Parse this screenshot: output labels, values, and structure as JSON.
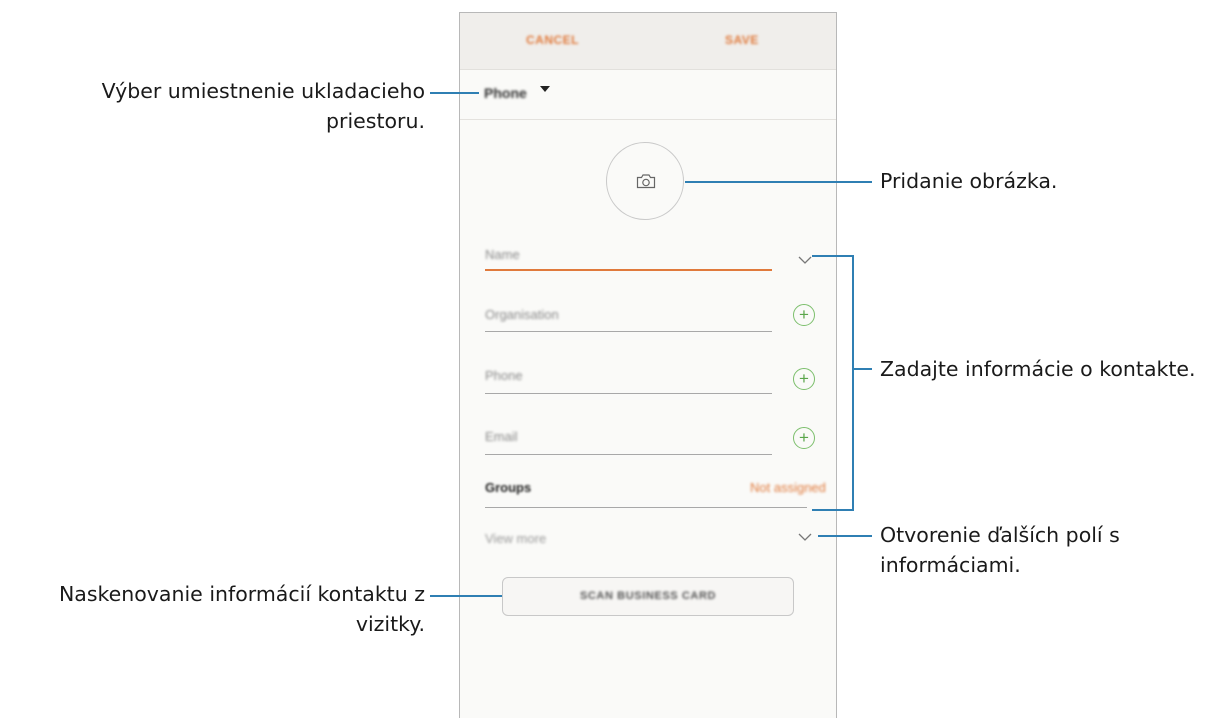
{
  "topbar": {
    "cancel_label": "CANCEL",
    "save_label": "SAVE"
  },
  "storage": {
    "label": "Phone"
  },
  "fields": {
    "name_placeholder": "Name",
    "organisation_placeholder": "Organisation",
    "phone_placeholder": "Phone",
    "email_placeholder": "Email"
  },
  "groups": {
    "label": "Groups",
    "value": "Not assigned"
  },
  "view_more_label": "View more",
  "scan_button_label": "SCAN BUSINESS CARD",
  "icons": [
    "camera-icon",
    "chevron-down-icon",
    "plus-icon",
    "dropdown-arrow-icon"
  ],
  "colors": {
    "accent": "#e07a3c",
    "plus_green": "#5aa64a",
    "callout_line": "#2f7fb3"
  },
  "callouts": {
    "storage_line1": "Výber umiestnenie ukladacieho",
    "storage_line2": "priestoru.",
    "picture": "Pridanie obrázka.",
    "contact_info": "Zadajte informácie o kontakte.",
    "more_fields_line1": "Otvorenie ďalších polí s",
    "more_fields_line2": "informáciami.",
    "scan_line1": "Naskenovanie informácií kontaktu z",
    "scan_line2": "vizitky."
  }
}
